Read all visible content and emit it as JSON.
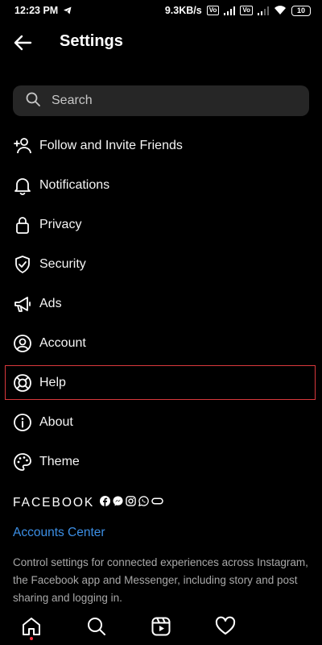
{
  "status_bar": {
    "time": "12:23 PM",
    "net_speed": "9.3KB/s",
    "net_badge_1": "Vo",
    "net_badge_2": "Vo",
    "battery": "10"
  },
  "header": {
    "title": "Settings"
  },
  "search": {
    "placeholder": "Search"
  },
  "menu": {
    "items": [
      {
        "label": "Follow and Invite Friends",
        "icon": "add-person-icon"
      },
      {
        "label": "Notifications",
        "icon": "bell-icon"
      },
      {
        "label": "Privacy",
        "icon": "lock-icon"
      },
      {
        "label": "Security",
        "icon": "shield-check-icon"
      },
      {
        "label": "Ads",
        "icon": "megaphone-icon"
      },
      {
        "label": "Account",
        "icon": "account-circle-icon"
      },
      {
        "label": "Help",
        "icon": "lifebuoy-icon",
        "highlighted": true
      },
      {
        "label": "About",
        "icon": "info-icon"
      },
      {
        "label": "Theme",
        "icon": "palette-icon"
      }
    ]
  },
  "facebook": {
    "brand": "FACEBOOK",
    "link": "Accounts Center",
    "description": "Control settings for connected experiences across Instagram, the Facebook app and Messenger, including story and post sharing and logging in."
  },
  "bottom_nav": [
    "home-icon",
    "search-icon",
    "reels-icon",
    "heart-icon"
  ],
  "colors": {
    "background": "#000000",
    "link": "#3c8fe5",
    "highlight_border": "#d9383c",
    "search_bg": "#262626"
  }
}
